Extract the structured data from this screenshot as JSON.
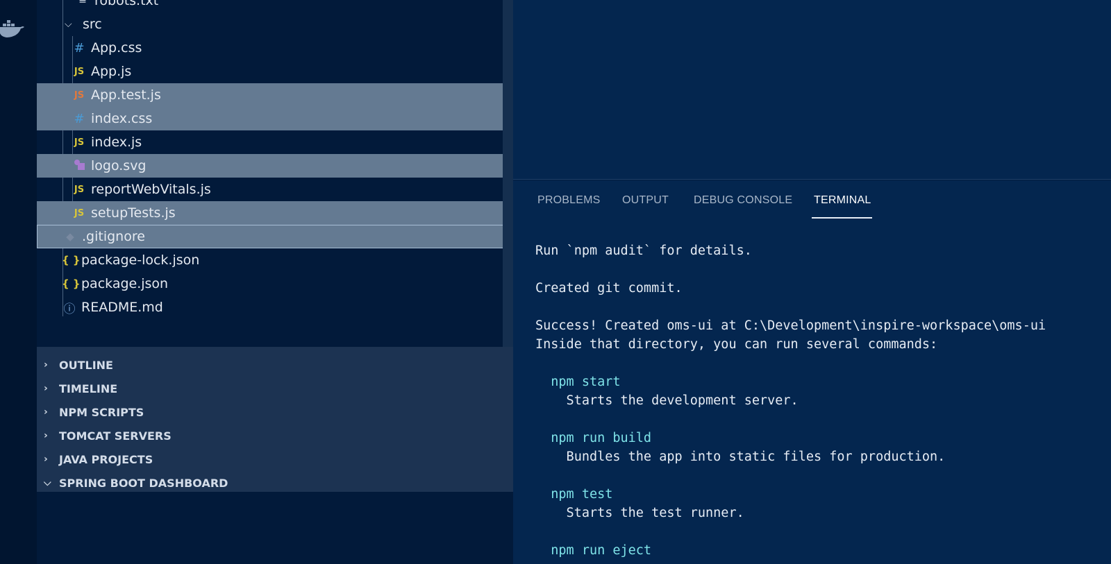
{
  "explorer": {
    "partial_top_item": "robots.txt",
    "folder_src": "src",
    "src_files": [
      {
        "label": "App.css",
        "icon": "css-icon"
      },
      {
        "label": "App.js",
        "icon": "js-icon"
      },
      {
        "label": "App.test.js",
        "icon": "js-test-icon"
      },
      {
        "label": "index.css",
        "icon": "css-icon"
      },
      {
        "label": "index.js",
        "icon": "js-icon"
      },
      {
        "label": "logo.svg",
        "icon": "svg-icon"
      },
      {
        "label": "reportWebVitals.js",
        "icon": "js-icon"
      },
      {
        "label": "setupTests.js",
        "icon": "js-icon"
      }
    ],
    "root_files": [
      {
        "label": ".gitignore",
        "icon": "git-icon"
      },
      {
        "label": "package-lock.json",
        "icon": "json-icon"
      },
      {
        "label": "package.json",
        "icon": "json-icon"
      },
      {
        "label": "README.md",
        "icon": "info-icon"
      }
    ],
    "js_glyph": "JS",
    "css_glyph": "#",
    "json_glyph": "{ }",
    "info_glyph": "ⓘ",
    "git_glyph": "◆"
  },
  "sections": [
    {
      "label": "OUTLINE",
      "expanded": false
    },
    {
      "label": "TIMELINE",
      "expanded": false
    },
    {
      "label": "NPM SCRIPTS",
      "expanded": false
    },
    {
      "label": "TOMCAT SERVERS",
      "expanded": false
    },
    {
      "label": "JAVA PROJECTS",
      "expanded": false
    },
    {
      "label": "SPRING BOOT DASHBOARD",
      "expanded": true
    }
  ],
  "panel": {
    "tabs": [
      "PROBLEMS",
      "OUTPUT",
      "DEBUG CONSOLE",
      "TERMINAL"
    ],
    "active_tab": "TERMINAL"
  },
  "terminal": {
    "line1": "Run `npm audit` for details.",
    "line2": "Created git commit.",
    "line3": "Success! Created oms-ui at C:\\Development\\inspire-workspace\\oms-ui",
    "line4": "Inside that directory, you can run several commands:",
    "cmd_start": "  npm start",
    "desc_start": "    Starts the development server.",
    "cmd_build": "  npm run build",
    "desc_build": "    Bundles the app into static files for production.",
    "cmd_test": "  npm test",
    "desc_test": "    Starts the test runner.",
    "cmd_eject": "  npm run eject"
  },
  "colors": {
    "background": "#04264f",
    "sidebar": "#021a3a",
    "selection": "#647a92",
    "command": "#7fe3e8"
  }
}
